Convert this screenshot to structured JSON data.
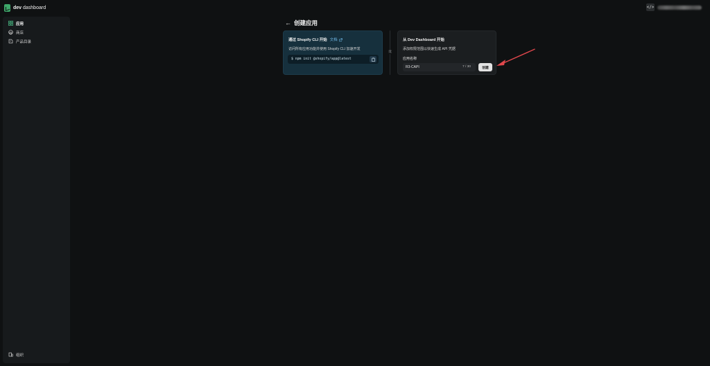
{
  "brand": {
    "name_bold": "dev",
    "name_rest": " dashboard"
  },
  "topbar": {
    "code_icon": "code-icon",
    "account_label": ""
  },
  "sidebar": {
    "items": [
      {
        "label": "应用",
        "icon": "apps-icon",
        "active": true
      },
      {
        "label": "商店",
        "icon": "store-icon",
        "active": false
      },
      {
        "label": "产品目录",
        "icon": "catalog-icon",
        "active": false
      }
    ],
    "bottom": {
      "label": "组织",
      "icon": "organization-icon"
    }
  },
  "page": {
    "back_label": "←",
    "title": "创建应用"
  },
  "cli_card": {
    "title": "通过 Shopify CLI 开始",
    "docs_label": "文档",
    "description": "访问所有应用功能并使用 Shopify CLI 加速开发",
    "command": "$ npm init @shopify/app@latest"
  },
  "divider_label": "或",
  "dashboard_card": {
    "title": "从 Dev Dashboard 开始",
    "description": "添加权限范围以快速生成 API 凭据",
    "field_label": "应用名称",
    "input_value": "R3-CAPI",
    "char_count": "7 / 30",
    "create_label": "创建"
  },
  "colors": {
    "accent_link": "#6fb7e6",
    "brand_green": "#3ea76a",
    "annotation_arrow": "#e0474c"
  }
}
